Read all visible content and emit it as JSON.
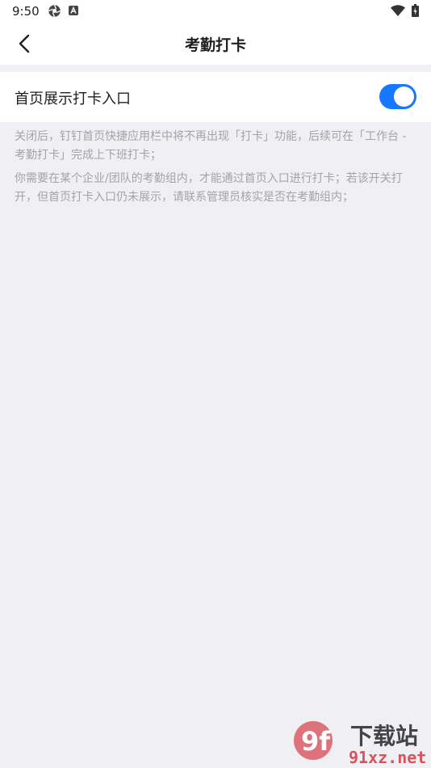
{
  "status_bar": {
    "time": "9:50"
  },
  "header": {
    "title": "考勤打卡"
  },
  "setting": {
    "label": "首页展示打卡入口",
    "enabled": true
  },
  "description": {
    "line1": "关闭后，钉钉首页快捷应用栏中将不再出现「打卡」功能，后续可在「工作台 - 考勤打卡」完成上下班打卡；",
    "line2": "你需要在某个企业/团队的考勤组内，才能通过首页入口进行打卡；若该开关打开，但首页打卡入口仍未展示，请联系管理员核实是否在考勤组内；"
  },
  "watermark": {
    "logo_text": "9f",
    "title": "下载站",
    "url": "91xz.net"
  },
  "colors": {
    "accent": "#1677ff",
    "page_bg": "#efeff4"
  }
}
